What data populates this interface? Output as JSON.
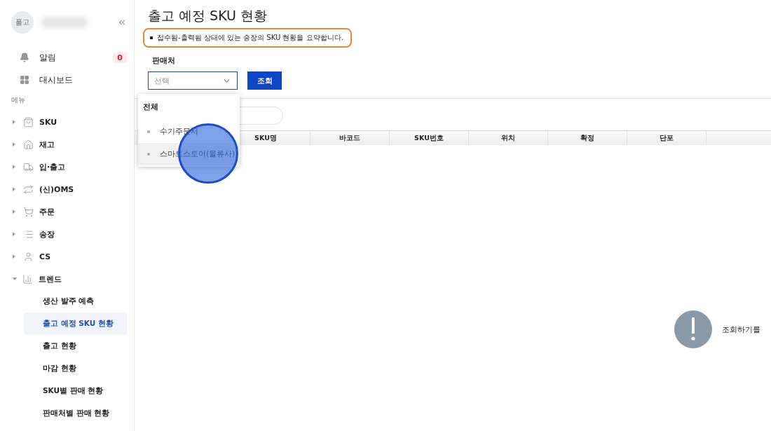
{
  "profile": {
    "avatar_text": "품고"
  },
  "top_items": [
    {
      "label": "알림",
      "badge": "0"
    },
    {
      "label": "대시보드"
    }
  ],
  "menu_heading": "메뉴",
  "menu": [
    {
      "label": "SKU",
      "expanded": false
    },
    {
      "label": "재고",
      "expanded": false
    },
    {
      "label": "입·출고",
      "expanded": false
    },
    {
      "label": "(신)OMS",
      "expanded": false
    },
    {
      "label": "주문",
      "expanded": false
    },
    {
      "label": "송장",
      "expanded": false
    },
    {
      "label": "CS",
      "expanded": false
    },
    {
      "label": "트렌드",
      "expanded": true,
      "children": [
        {
          "label": "생산 발주 예측",
          "selected": false
        },
        {
          "label": "출고 예정 SKU 현황",
          "selected": true
        },
        {
          "label": "출고 현황",
          "selected": false
        },
        {
          "label": "마감 현황",
          "selected": false
        },
        {
          "label": "SKU별 판매 현황",
          "selected": false
        },
        {
          "label": "판매처별 판매 현황",
          "selected": false
        }
      ]
    }
  ],
  "page": {
    "title": "출고 예정 SKU 현황",
    "note": "접수됨-출력됨 상태에 있는 송장의 SKU 현황을 요약합니다.",
    "filter_label": "판매처",
    "select": {
      "placeholder": "선택",
      "expanded": true
    },
    "search_button": "조회",
    "dropdown": {
      "heading": "전체",
      "options": [
        {
          "label": "수기주문서",
          "selected": false
        },
        {
          "label": "스마트스토어(물류사)",
          "selected": true
        }
      ]
    },
    "table": {
      "columns": [
        "SKU명",
        "바코드",
        "SKU번호",
        "위치",
        "확정",
        "단포"
      ]
    },
    "empty_message": "조회하기를"
  }
}
